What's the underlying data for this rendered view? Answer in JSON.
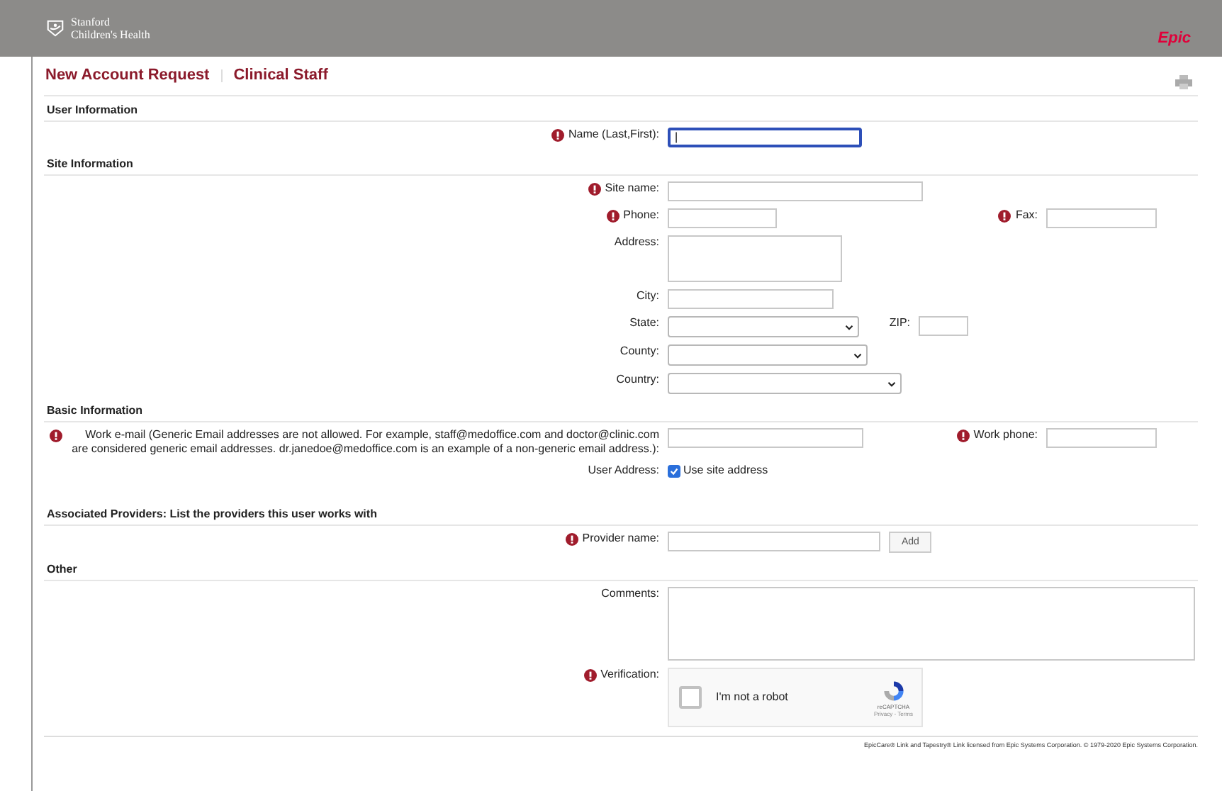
{
  "header": {
    "brand_line1": "Stanford",
    "brand_line2": "Children's Health",
    "vendor": "Epic"
  },
  "title": {
    "main": "New Account Request",
    "sub": "Clinical Staff"
  },
  "sections": [
    {
      "heading": "User Information",
      "rows": [
        {
          "fields": [
            {
              "kind": "input",
              "label": "Name (Last,First):",
              "required": true,
              "focused": true,
              "value": "|"
            }
          ]
        }
      ]
    },
    {
      "heading": "Site Information",
      "rows": [
        {
          "fields": [
            {
              "kind": "input",
              "label": "Site name:",
              "required": true,
              "focused": false
            }
          ]
        },
        {
          "fields": [
            {
              "kind": "input",
              "label": "Phone:",
              "required": true,
              "focused": false
            },
            {
              "kind": "input",
              "label": "Fax:",
              "required": true,
              "focused": false
            }
          ]
        },
        {
          "fields": [
            {
              "kind": "textarea",
              "label": "Address:",
              "required": false
            }
          ]
        },
        {
          "fields": [
            {
              "kind": "input",
              "label": "City:",
              "required": false,
              "focused": false
            }
          ]
        },
        {
          "fields": [
            {
              "kind": "select",
              "label": "State:",
              "required": false
            },
            {
              "kind": "input",
              "label": "ZIP:",
              "required": false,
              "focused": false
            }
          ]
        },
        {
          "fields": [
            {
              "kind": "select",
              "label": "County:",
              "required": false
            }
          ]
        },
        {
          "fields": [
            {
              "kind": "select",
              "label": "Country:",
              "required": false
            }
          ]
        }
      ]
    },
    {
      "heading": "Basic Information",
      "rows": [
        {
          "fields": [
            {
              "kind": "input",
              "label": "Work e-mail (Generic Email addresses are not allowed. For example, staff@medoffice.com and doctor@clinic.com are considered generic email addresses. dr.janedoe@medoffice.com is an example of a non-generic email address.):",
              "required": true,
              "focused": false
            },
            {
              "kind": "input",
              "label": "Work phone:",
              "required": true,
              "focused": false
            }
          ]
        },
        {
          "fields": [
            {
              "kind": "checkbox",
              "label": "User Address:",
              "required": false,
              "checked": true,
              "text": "Use site address"
            }
          ]
        }
      ]
    },
    {
      "heading": "Associated Providers: List the providers this user works with",
      "rows": [
        {
          "fields": [
            {
              "kind": "input",
              "label": "Provider name:",
              "required": true,
              "focused": false
            },
            {
              "kind": "button",
              "text": "Add"
            }
          ]
        }
      ]
    },
    {
      "heading": "Other",
      "rows": [
        {
          "fields": [
            {
              "kind": "textarea",
              "label": "Comments:",
              "required": false
            }
          ]
        },
        {
          "fields": [
            {
              "kind": "captcha",
              "label": "Verification:",
              "required": true,
              "checked": false,
              "text": "I'm not a robot",
              "badge_line1": "reCAPTCHA",
              "badge_line2": "Privacy - Terms"
            }
          ]
        }
      ]
    }
  ],
  "footer": "EpicCare® Link and Tapestry® Link licensed from Epic Systems Corporation. © 1979-2020 Epic Systems Corporation."
}
